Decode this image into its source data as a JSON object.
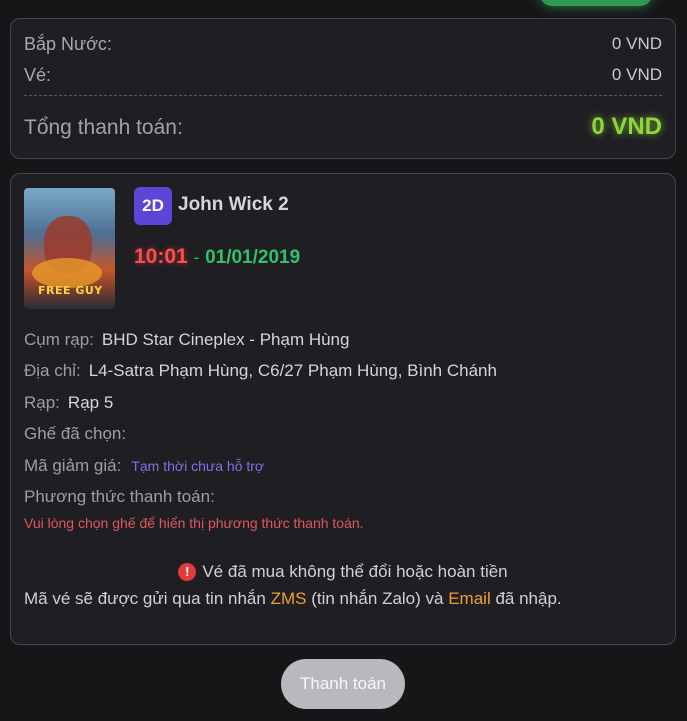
{
  "summary": {
    "snacks_label": "Bắp Nước:",
    "snacks_value": "0 VND",
    "ticket_label": "Vé:",
    "ticket_value": "0 VND",
    "total_label": "Tổng thanh toán:",
    "total_value": "0 VND"
  },
  "movie": {
    "format": "2D",
    "title": "John Wick 2",
    "time": "10:01",
    "separator": "-",
    "date": "01/01/2019",
    "poster_text": "FREE GUY"
  },
  "details": {
    "cinema_label": "Cụm rạp:",
    "cinema_value": "BHD Star Cineplex - Phạm Hùng",
    "address_label": "Địa chỉ:",
    "address_value": "L4-Satra Phạm Hùng, C6/27 Phạm Hùng, Bình Chánh",
    "room_label": "Rạp:",
    "room_value": "Rạp 5",
    "seats_label": "Ghế đã chọn:",
    "seats_value": "",
    "promo_label": "Mã giảm giá:",
    "promo_value": "Tạm thời chưa hỗ trợ",
    "payment_label": "Phương thức thanh toán:",
    "payment_warning": "Vui lòng chọn ghế để hiển thị phương thức thanh toán."
  },
  "notice": {
    "icon": "exclamation-icon",
    "no_refund": "Vé đã mua không thể đổi hoặc hoàn tiền",
    "sms_prefix": "Mã vé sẽ được gửi qua tin nhắn",
    "zms": "ZMS",
    "sms_middle": "(tin nhắn Zalo) và",
    "email": "Email",
    "sms_suffix": "đã nhập."
  },
  "actions": {
    "pay_label": "Thanh toán"
  },
  "colors": {
    "total": "#8fd63a",
    "time": "#ff4d4d",
    "date": "#33c06b",
    "badge": "#5e45d6",
    "highlight": "#f29f2a",
    "warning": "#e0565d"
  }
}
